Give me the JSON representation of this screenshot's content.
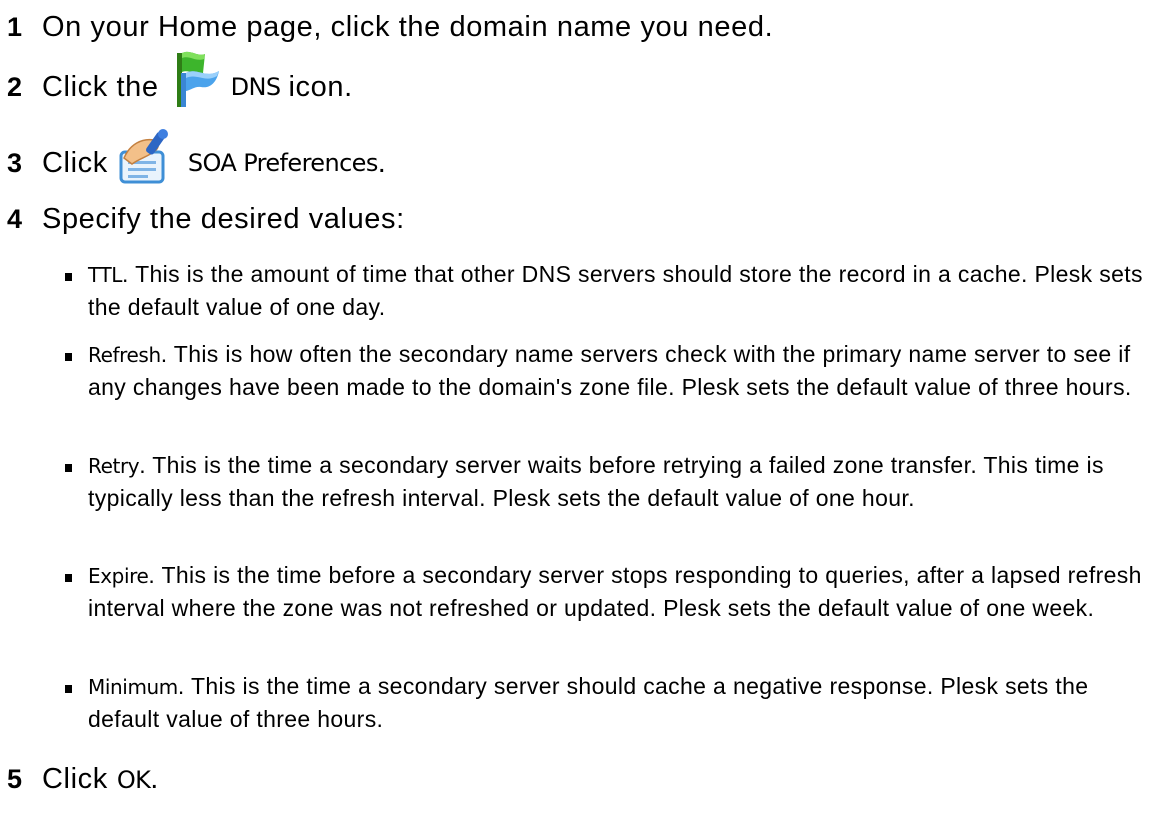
{
  "steps": [
    {
      "number": "1",
      "before": "On your Home page, click the domain name you need."
    },
    {
      "number": "2",
      "before": "Click the",
      "icon": "dns-flags-icon",
      "ui_label": "DNS",
      "after": "icon."
    },
    {
      "number": "3",
      "before": "Click",
      "icon": "soa-preferences-icon",
      "ui_label": "SOA Preferences",
      "after": "."
    },
    {
      "number": "4",
      "before": "Specify the desired values:"
    },
    {
      "number": "5",
      "before": "Click",
      "ui_label": "OK",
      "after": "."
    }
  ],
  "settings": [
    {
      "term": "TTL",
      "text": ". This is the amount of time that other DNS servers should store the record in a cache. Plesk sets the default value of one day."
    },
    {
      "term": "Refresh",
      "text": ". This is how often the secondary name servers check with the primary name server to see if any changes have been made to the domain's zone file. Plesk sets the default value of three hours."
    },
    {
      "term": "Retry",
      "text": ". This is the time a secondary server waits before retrying a failed zone transfer. This time is typically less than the refresh interval. Plesk sets the default value of one hour."
    },
    {
      "term": "Expire",
      "text": ". This is the time before a secondary server stops responding to queries, after a lapsed refresh interval where the zone was not refreshed or updated. Plesk sets the default value of one week."
    },
    {
      "term": "Minimum",
      "text": ". This is the time a secondary server should cache a negative response. Plesk sets the default value of three hours."
    }
  ]
}
